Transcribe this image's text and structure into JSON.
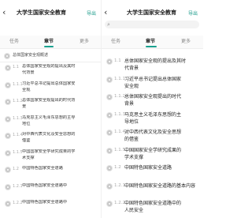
{
  "left": {
    "title": "大学生国家安全教育",
    "action": "导出",
    "tabs": [
      "任务",
      "章节",
      "更多"
    ],
    "active_tab": 1,
    "chapter": {
      "title": "总体国家安全观概述"
    },
    "sections": [
      {
        "num": "1.1",
        "lines": [
          "总体国家安全观的提出及其时",
          "代背景"
        ]
      },
      {
        "num": "1.1.1",
        "lines": [
          "习近平总书记提出总体国家安",
          "全观"
        ]
      },
      {
        "num": "1.1.2",
        "lines": [
          "总体国家安全观提出的时代背",
          "景"
        ]
      },
      {
        "num": "1.1.3",
        "lines": [
          "马克思主义毛泽东思想的主导",
          "地位"
        ]
      },
      {
        "num": "1.1.4",
        "lines": [
          "对中西代表文化及安全思想的",
          "借鉴"
        ]
      },
      {
        "num": "1.1.5",
        "lines": [
          "中国国家安全学研究成果的学",
          "术支撑"
        ]
      },
      {
        "num": "1.2",
        "lines": [
          "中国特色国家安全道路"
        ]
      },
      {
        "num": "1.2.1",
        "lines": [
          "中国特色国家安全道路中"
        ]
      },
      {
        "num": "1.2.2",
        "lines": [
          "中国特色国家安全道路中"
        ]
      }
    ]
  },
  "right": {
    "title": "大学生国家安全教育",
    "action": "导出",
    "search_placeholder": "",
    "tabs": [
      "任务",
      "章节",
      "更多"
    ],
    "active_tab": 1,
    "sections": [
      {
        "num": "1.1",
        "lines": [
          "总体国家安全观的提出及其时",
          "代背景"
        ]
      },
      {
        "num": "1.1.1",
        "lines": [
          "习近平总书记提出总体国家",
          "安全观"
        ]
      },
      {
        "num": "1.1.2",
        "lines": [
          "总体国家安全观提出的时代",
          "背景"
        ]
      },
      {
        "num": "1.1.3",
        "lines": [
          "马克思主义毛泽东思想的主",
          "导地位"
        ]
      },
      {
        "num": "1.1.4",
        "lines": [
          "对中西代表文化及安全思想",
          "的借鉴"
        ]
      },
      {
        "num": "1.1.5",
        "lines": [
          "中国国家安全学研究成果的",
          "学术支撑"
        ]
      },
      {
        "num": "1.2",
        "lines": [
          "中国特色国家安全道路"
        ]
      },
      {
        "num": "1.2.1",
        "lines": [
          "中国特色国家安全道路的基本内容"
        ]
      },
      {
        "num": "1.2.2",
        "lines": [
          "中国特色国家安全道路中的",
          "人民安全"
        ]
      }
    ]
  },
  "colors": {
    "accent": "#1aa18f",
    "radio": "#c8c8c8",
    "divider": "#eeeeee"
  },
  "icons": {
    "back": "back-arrow-icon",
    "search": "search-icon",
    "status": "radio-status-icon"
  }
}
